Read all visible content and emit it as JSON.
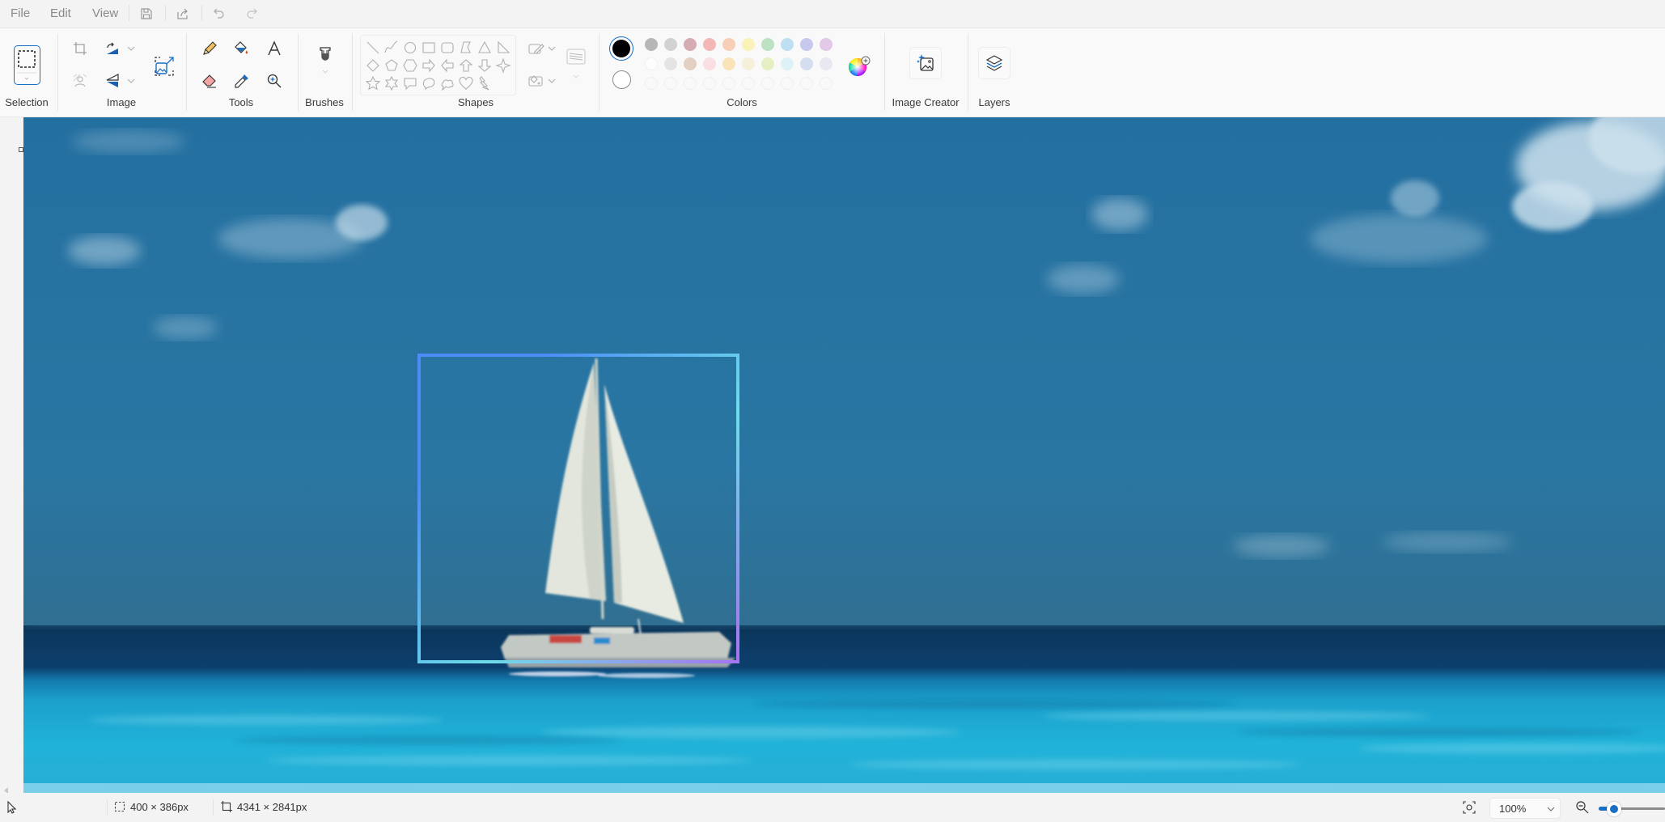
{
  "menu": {
    "items": [
      "File",
      "Edit",
      "View"
    ],
    "quick_actions": [
      "save-icon",
      "share-icon",
      "undo-icon",
      "redo-icon"
    ]
  },
  "ribbon": {
    "groups": {
      "selection": {
        "label": "Selection"
      },
      "image": {
        "label": "Image",
        "tools": [
          "crop-icon",
          "rotate-icon",
          "remove-background-icon",
          "flip-icon",
          "resize-icon"
        ]
      },
      "tools": {
        "label": "Tools",
        "tools": [
          "pencil-icon",
          "fill-icon",
          "text-icon",
          "eraser-icon",
          "color-picker-icon",
          "magnifier-icon"
        ]
      },
      "brushes": {
        "label": "Brushes"
      },
      "shapes": {
        "label": "Shapes",
        "items": [
          "line",
          "curve",
          "oval",
          "rectangle",
          "rounded-rectangle",
          "polygon",
          "triangle",
          "right-triangle",
          "diamond",
          "pentagon",
          "hexagon",
          "arrow-right",
          "arrow-left",
          "arrow-up",
          "arrow-down",
          "star-four",
          "star-five",
          "star-six",
          "callout-rect",
          "callout-oval",
          "callout-cloud",
          "heart",
          "lightning"
        ],
        "outline_label": "Outline",
        "fill_label": "Fill"
      },
      "colors": {
        "label": "Colors",
        "primary": "#000000",
        "secondary": "#ffffff",
        "palette_row1": [
          "#a0a0a0",
          "#c4c4c4",
          "#c89298",
          "#f0a0a0",
          "#f5c0a0",
          "#f8f0a0",
          "#a8d8b0",
          "#a8d6ee",
          "#b4b8e8",
          "#d8b8e0"
        ],
        "palette_row2": [
          "#ffffff",
          "#dcdcdc",
          "#dcc0b0",
          "#f8d4dc",
          "#f8dca0",
          "#f4ecd0",
          "#dcecb0",
          "#d4eef4",
          "#c8d4ec",
          "#e4e0f0"
        ],
        "custom_slots": 10
      },
      "image_creator": {
        "label": "Image Creator"
      },
      "layers": {
        "label": "Layers"
      }
    }
  },
  "canvas": {
    "sky_color": "#2672a0",
    "selection_gradient": [
      "#4c8cf8",
      "#6ddde8",
      "#a673f3"
    ]
  },
  "status": {
    "selection_size": "400 × 386px",
    "canvas_size": "4341 × 2841px",
    "zoom_level": "100%",
    "zoom_slider_fraction": 0.08
  }
}
